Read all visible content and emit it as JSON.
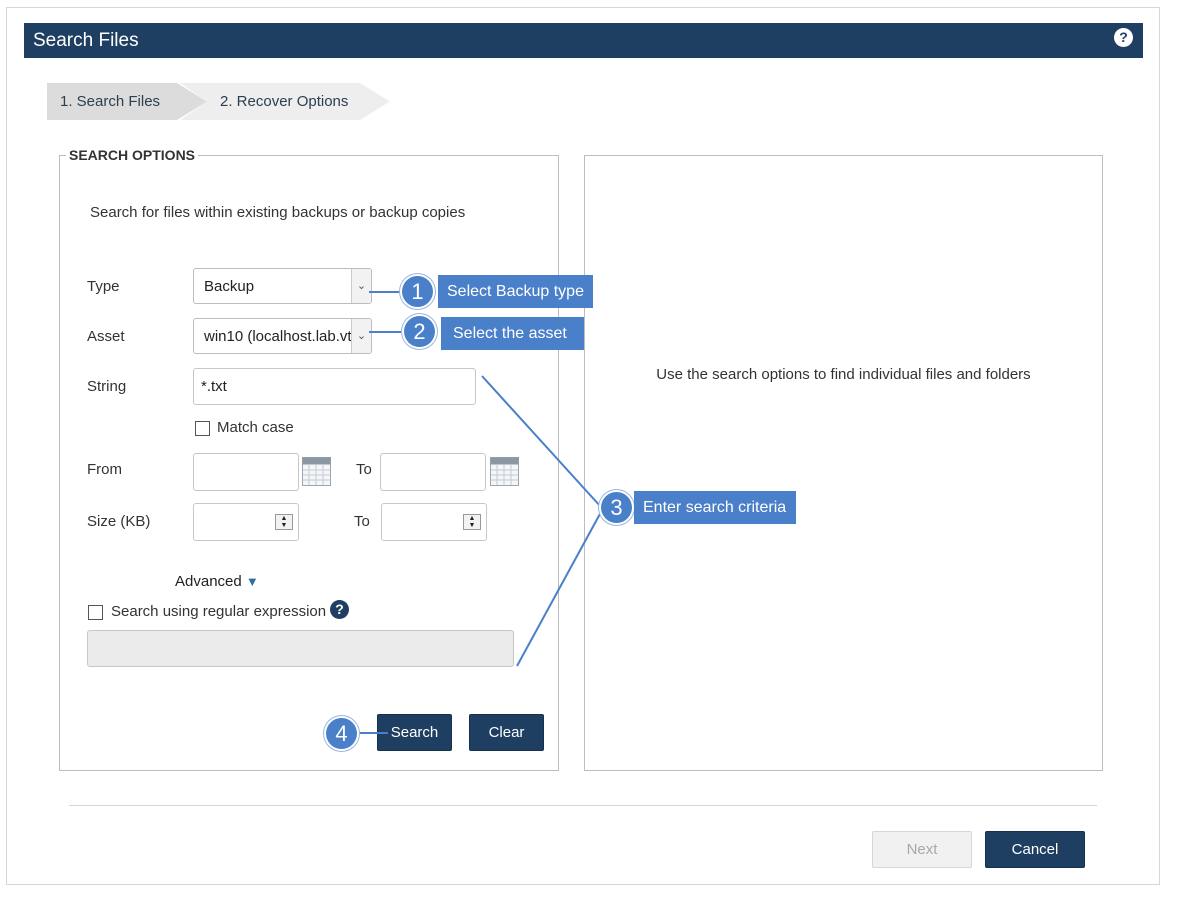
{
  "dialog": {
    "title": "Search Files",
    "help_icon": "question-circle-icon"
  },
  "steps": [
    {
      "label": "1. Search Files",
      "active": true
    },
    {
      "label": "2. Recover Options",
      "active": false
    }
  ],
  "search_options": {
    "legend": "SEARCH OPTIONS",
    "intro": "Search for files within existing backups or backup copies",
    "type": {
      "label": "Type",
      "value": "Backup"
    },
    "asset": {
      "label": "Asset",
      "value": "win10 (localhost.lab.vtc"
    },
    "string": {
      "label": "String",
      "value": "*.txt"
    },
    "match_case": {
      "label": "Match case",
      "checked": false
    },
    "from": {
      "label": "From",
      "value": ""
    },
    "to_date": {
      "label": "To",
      "value": ""
    },
    "size": {
      "label": "Size (KB)",
      "value": ""
    },
    "to_size": {
      "label": "To",
      "value": ""
    },
    "advanced": {
      "label": "Advanced",
      "arrow": "▼"
    },
    "regex": {
      "label": "Search using regular expression",
      "checked": false,
      "value": ""
    },
    "search_button": "Search",
    "clear_button": "Clear"
  },
  "results_panel": {
    "placeholder": "Use the search options to find individual files and folders"
  },
  "footer": {
    "next_button": "Next",
    "cancel_button": "Cancel"
  },
  "callouts": [
    {
      "number": "1",
      "text": "Select Backup type"
    },
    {
      "number": "2",
      "text": "Select the asset"
    },
    {
      "number": "3",
      "text": "Enter search criteria"
    },
    {
      "number": "4",
      "text": ""
    }
  ],
  "colors": {
    "header": "#1f3f62",
    "callout": "#4a7fc9",
    "step_active": "#dcdcdc",
    "step_inactive": "#eeeeee"
  }
}
